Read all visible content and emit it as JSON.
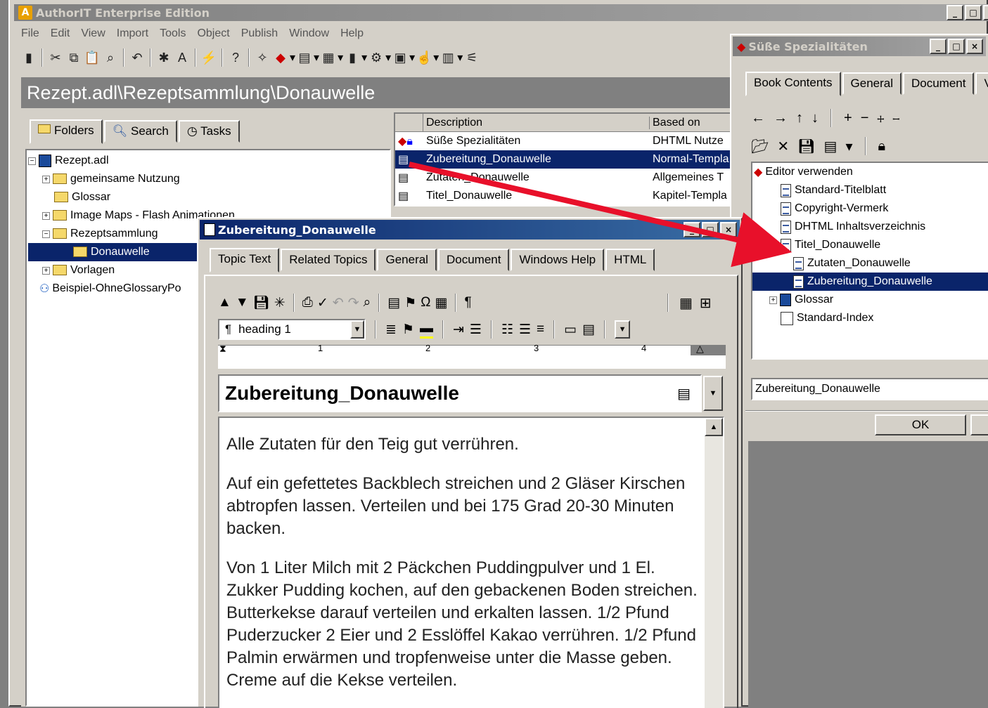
{
  "app": {
    "title": "AuthorIT Enterprise Edition",
    "menu": [
      "File",
      "Edit",
      "View",
      "Import",
      "Tools",
      "Object",
      "Publish",
      "Window",
      "Help"
    ],
    "path": "Rezept.adl\\Rezeptsammlung\\Donauwelle"
  },
  "left_panel": {
    "tabs": [
      "Folders",
      "Search",
      "Tasks"
    ],
    "tree": [
      {
        "label": "Rezept.adl"
      },
      {
        "label": "gemeinsame Nutzung"
      },
      {
        "label": "Glossar"
      },
      {
        "label": "Image Maps - Flash Animationen"
      },
      {
        "label": "Rezeptsammlung"
      },
      {
        "label": "Donauwelle"
      },
      {
        "label": "Vorlagen"
      },
      {
        "label": "Beispiel-OhneGlossaryPo"
      }
    ]
  },
  "object_list": {
    "columns": [
      "Description",
      "Based on"
    ],
    "rows": [
      {
        "description": "Süße Spezialitäten",
        "based_on": "DHTML Nutze"
      },
      {
        "description": "Zubereitung_Donauwelle",
        "based_on": "Normal-Templa"
      },
      {
        "description": "Zutaten_Donauwelle",
        "based_on": "Allgemeines T"
      },
      {
        "description": "Titel_Donauwelle",
        "based_on": "Kapitel-Templa"
      }
    ]
  },
  "book_window": {
    "title": "Süße Spezialitäten",
    "tabs": [
      "Book Contents",
      "General",
      "Document",
      "V"
    ],
    "root": "Editor verwenden",
    "items": [
      {
        "label": "Standard-Titelblatt"
      },
      {
        "label": "Copyright-Vermerk"
      },
      {
        "label": "DHTML Inhaltsverzeichnis"
      },
      {
        "label": "Titel_Donauwelle"
      },
      {
        "label": "Zutaten_Donauwelle"
      },
      {
        "label": "Zubereitung_Donauwelle"
      },
      {
        "label": "Glossar"
      },
      {
        "label": "Standard-Index"
      }
    ],
    "status": "Zubereitung_Donauwelle",
    "ok_label": "OK"
  },
  "topic_window": {
    "title": "Zubereitung_Donauwelle",
    "tabs": [
      "Topic Text",
      "Related Topics",
      "General",
      "Document",
      "Windows Help",
      "HTML"
    ],
    "style_value": "heading 1",
    "ruler_marks": [
      "1",
      "2",
      "3",
      "4"
    ],
    "heading": "Zubereitung_Donauwelle",
    "paragraphs": [
      "Alle Zutaten für den Teig gut verrühren.",
      "Auf ein gefettetes Backblech streichen und 2 Gläser Kirschen abtropfen lassen. Verteilen und bei 175 Grad 20-30 Minuten backen.",
      "Von 1 Liter Milch mit 2 Päckchen Puddingpulver und 1 El. Zukker Pudding kochen, auf den gebackenen Boden streichen. Butterkekse darauf verteilen und erkalten lassen. 1/2 Pfund Puderzucker 2 Eier und 2 Esslöffel Kakao verrühren. 1/2 Pfund Palmin erwärmen und tropfenweise unter die Masse geben. Creme auf die Kekse verteilen."
    ]
  },
  "colors": {
    "selection": "#0a246a",
    "arrow": "#e8102a"
  }
}
